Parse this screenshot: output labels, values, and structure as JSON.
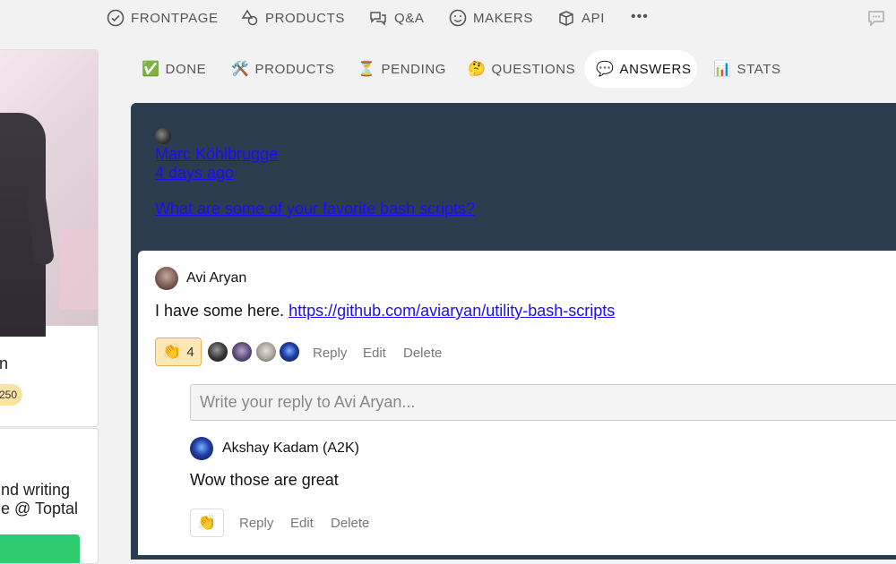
{
  "topnav": {
    "items": [
      {
        "label": "FRONTPAGE",
        "icon": "check-circle-icon"
      },
      {
        "label": "PRODUCTS",
        "icon": "shapes-icon"
      },
      {
        "label": "Q&A",
        "icon": "chat-bubbles-icon"
      },
      {
        "label": "MAKERS",
        "icon": "smiley-icon"
      },
      {
        "label": "API",
        "icon": "cube-icon"
      }
    ],
    "more": "•••"
  },
  "profile": {
    "name_fragment": "n",
    "points_fragment": "250",
    "bio_line1": "nd writing",
    "bio_line2": "e @ Toptal"
  },
  "tabs": [
    {
      "emoji": "✅",
      "label": "DONE"
    },
    {
      "emoji": "🛠️",
      "label": "PRODUCTS"
    },
    {
      "emoji": "⏳",
      "label": "PENDING"
    },
    {
      "emoji": "🤔",
      "label": "QUESTIONS"
    },
    {
      "emoji": "💬",
      "label": "ANSWERS",
      "active": true
    },
    {
      "emoji": "📊",
      "label": "STATS"
    }
  ],
  "question": {
    "author": "Marc Köhlbrugge",
    "time": "4 days ago",
    "title": "What are some of your favorite bash scripts?"
  },
  "answer": {
    "author": "Avi Aryan",
    "text": "I have some here. ",
    "link": "https://github.com/aviaryan/utility-bash-scripts",
    "clap_emoji": "👏",
    "clap_count": "4",
    "actions": {
      "reply": "Reply",
      "edit": "Edit",
      "delete": "Delete"
    },
    "reply_placeholder": "Write your reply to Avi Aryan..."
  },
  "reply": {
    "author": "Akshay Kadam (A2K)",
    "text": "Wow those are great",
    "clap_emoji": "👏",
    "actions": {
      "reply": "Reply",
      "edit": "Edit",
      "delete": "Delete"
    }
  },
  "colors": {
    "question_bg": "#2b3c4f",
    "link": "#1a0dff",
    "clap_bg": "#fde8b3",
    "accent_green": "#2ecc71"
  }
}
